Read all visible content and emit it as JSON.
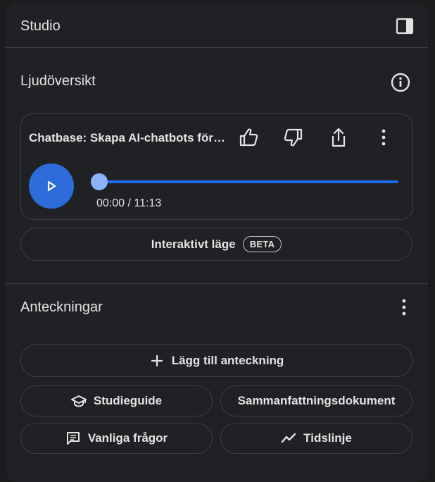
{
  "header": {
    "title": "Studio"
  },
  "audio_overview": {
    "title": "Ljudöversikt",
    "item_title": "Chatbase: Skapa AI-chatbots för din webbplats",
    "time_current": "00:00",
    "time_separator": " / ",
    "time_total": "11:13",
    "progress_fraction": 0.0,
    "interactive_label": "Interaktivt läge",
    "beta_label": "BETA"
  },
  "notes": {
    "title": "Anteckningar",
    "add_note_label": "Lägg till anteckning",
    "buttons": {
      "study_guide": "Studieguide",
      "summary_doc": "Sammanfattningsdokument",
      "faq": "Vanliga frågor",
      "timeline": "Tidslinje"
    }
  },
  "colors": {
    "background": "#202124",
    "accent": "#2e6cdb",
    "progress_thumb": "#8ab4f8",
    "border": "#3c4043"
  },
  "icons": {
    "panel_toggle": "panel-toggle-icon",
    "info": "info-icon",
    "like": "thumbs-up-icon",
    "dislike": "thumbs-down-icon",
    "share": "share-icon",
    "more": "more-vert-icon",
    "play": "play-icon",
    "add": "plus-icon",
    "study": "school-icon",
    "faq": "chat-lines-icon",
    "timeline": "trend-icon"
  }
}
